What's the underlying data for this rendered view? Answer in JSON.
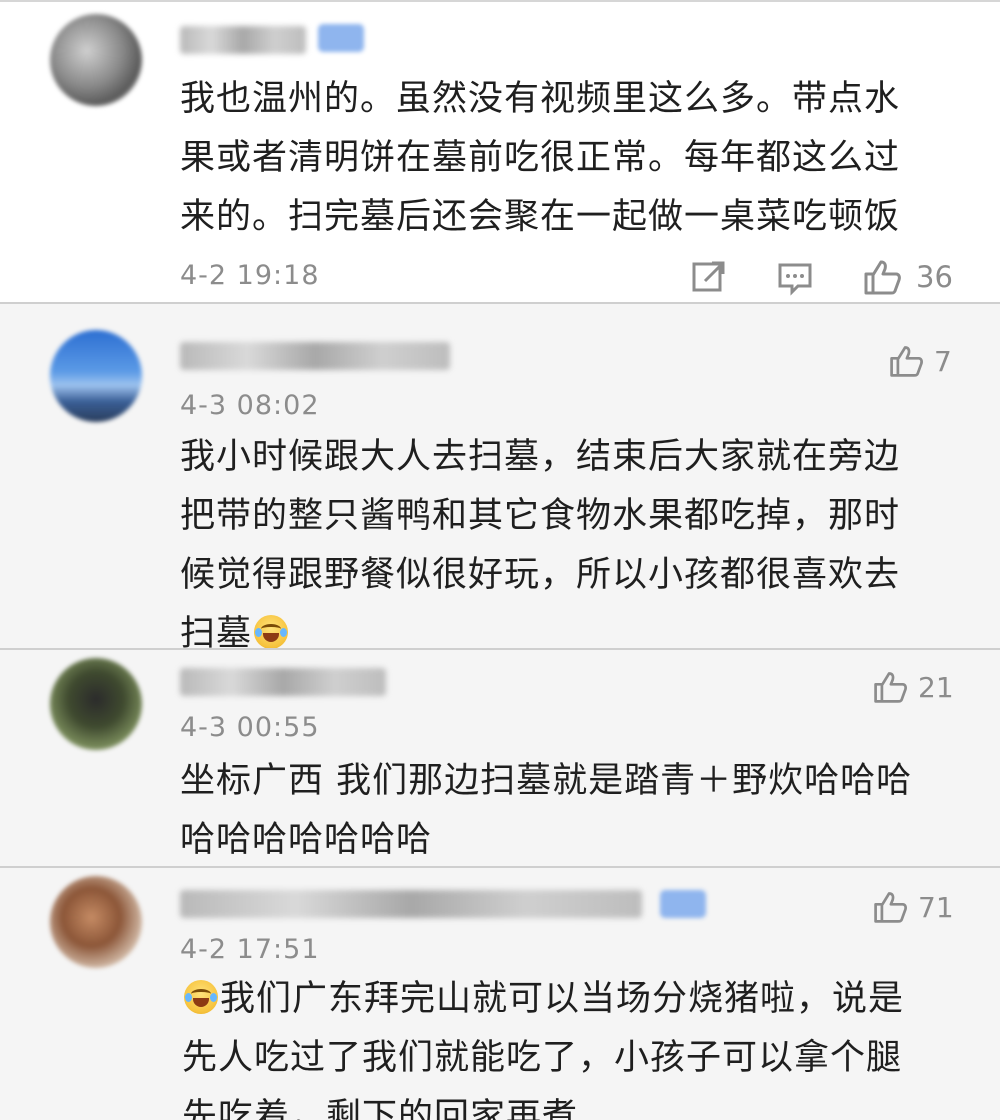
{
  "comments": [
    {
      "text_lines": [
        "我也温州的。虽然没有视频里这么多。带点水",
        "果或者清明饼在墓前吃很正常。每年都这么过",
        "来的。扫完墓后还会聚在一起做一桌菜吃顿饭"
      ],
      "time": "4-2 19:18",
      "likes": "36",
      "actions": [
        "share-icon",
        "reply-icon",
        "like-icon"
      ]
    },
    {
      "time": "4-3 08:02",
      "likes": "7",
      "text_lines": [
        "我小时候跟大人去扫墓，结束后大家就在旁边",
        "把带的整只酱鸭和其它食物水果都吃掉，那时",
        "候觉得跟野餐似很好玩，所以小孩都很喜欢去",
        "扫墓"
      ],
      "emoji": "laugh-cry-emoji"
    },
    {
      "time": "4-3 00:55",
      "likes": "21",
      "text_lines": [
        "坐标广西 我们那边扫墓就是踏青＋野炊哈哈哈",
        "哈哈哈哈哈哈哈"
      ]
    },
    {
      "time": "4-2 17:51",
      "likes": "71",
      "emoji": "laugh-cry-emoji",
      "text_lines": [
        "我们广东拜完山就可以当场分烧猪啦，说是",
        "先人吃过了我们就能吃了，小孩子可以拿个腿",
        "先吃着，剩下的回家再煮"
      ]
    }
  ],
  "colors": {
    "meta": "#8c8c8c",
    "vip_badge": "#8fb5ee",
    "divider": "#cfcfcf"
  }
}
